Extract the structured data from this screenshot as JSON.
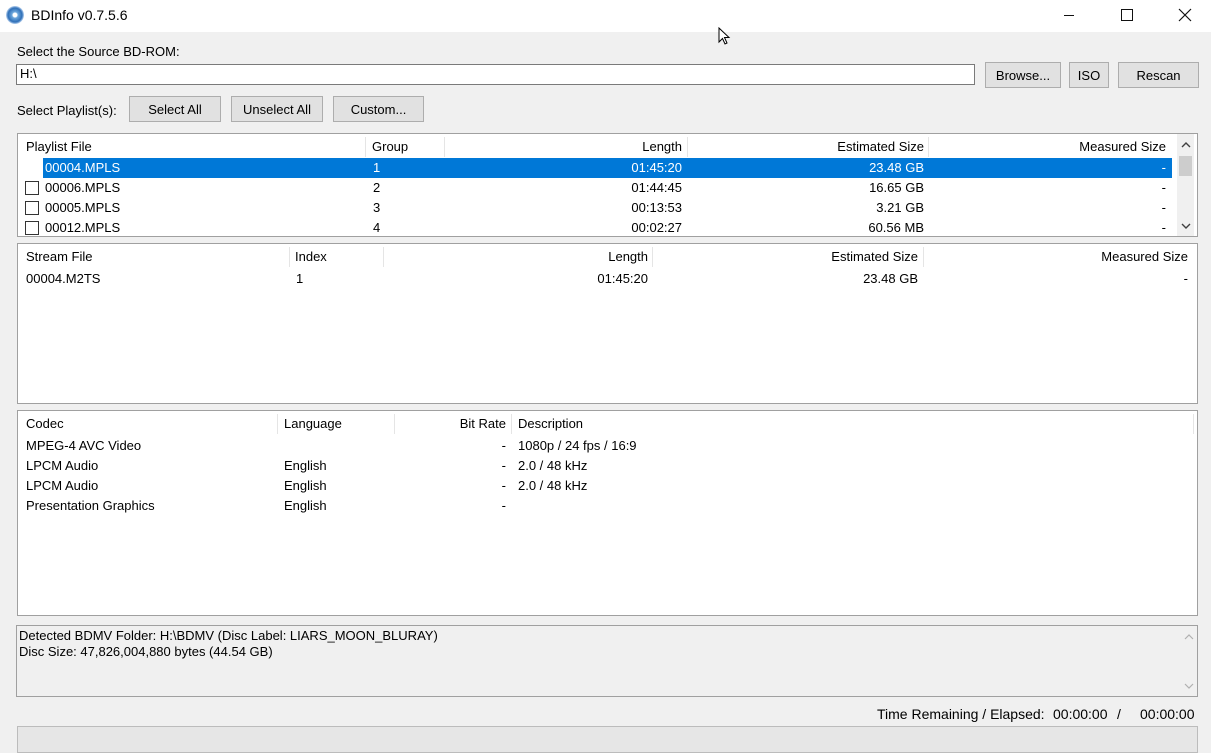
{
  "window": {
    "title": "BDInfo v0.7.5.6"
  },
  "source": {
    "label": "Select the Source BD-ROM:",
    "path": "H:\\"
  },
  "buttons": {
    "browse": "Browse...",
    "iso": "ISO",
    "rescan": "Rescan",
    "select_all": "Select All",
    "unselect_all": "Unselect All",
    "custom": "Custom..."
  },
  "playlist_label": "Select Playlist(s):",
  "playlists": {
    "headers": [
      "Playlist File",
      "Group",
      "Length",
      "Estimated Size",
      "Measured Size"
    ],
    "rows": [
      {
        "file": "00004.MPLS",
        "group": "1",
        "length": "01:45:20",
        "est": "23.48 GB",
        "measured": "-",
        "selected": true
      },
      {
        "file": "00006.MPLS",
        "group": "2",
        "length": "01:44:45",
        "est": "16.65 GB",
        "measured": "-",
        "selected": false
      },
      {
        "file": "00005.MPLS",
        "group": "3",
        "length": "00:13:53",
        "est": "3.21 GB",
        "measured": "-",
        "selected": false
      },
      {
        "file": "00012.MPLS",
        "group": "4",
        "length": "00:02:27",
        "est": "60.56 MB",
        "measured": "-",
        "selected": false
      }
    ]
  },
  "streams": {
    "headers": [
      "Stream File",
      "Index",
      "Length",
      "Estimated Size",
      "Measured Size"
    ],
    "rows": [
      {
        "file": "00004.M2TS",
        "index": "1",
        "length": "01:45:20",
        "est": "23.48 GB",
        "measured": "-"
      }
    ]
  },
  "codecs": {
    "headers": [
      "Codec",
      "Language",
      "Bit Rate",
      "Description"
    ],
    "rows": [
      {
        "codec": "MPEG-4 AVC Video",
        "language": "",
        "bitrate": "-",
        "desc": "1080p / 24 fps / 16:9"
      },
      {
        "codec": "LPCM Audio",
        "language": "English",
        "bitrate": "-",
        "desc": "2.0 / 48 kHz"
      },
      {
        "codec": "LPCM Audio",
        "language": "English",
        "bitrate": "-",
        "desc": "2.0 / 48 kHz"
      },
      {
        "codec": "Presentation Graphics",
        "language": "English",
        "bitrate": "-",
        "desc": ""
      }
    ]
  },
  "log": {
    "line1": "Detected BDMV Folder: H:\\BDMV (Disc Label: LIARS_MOON_BLURAY)",
    "line2": "Disc Size: 47,826,004,880 bytes (44.54 GB)"
  },
  "status": {
    "label": "Time Remaining / Elapsed:",
    "remaining": "00:00:00",
    "separator": "/",
    "elapsed": "00:00:00"
  },
  "icons": {
    "app": "disc-icon",
    "minimize": "minimize-icon",
    "maximize": "maximize-icon",
    "close": "close-icon",
    "scroll_up": "chevron-up-icon",
    "scroll_down": "chevron-down-icon"
  }
}
